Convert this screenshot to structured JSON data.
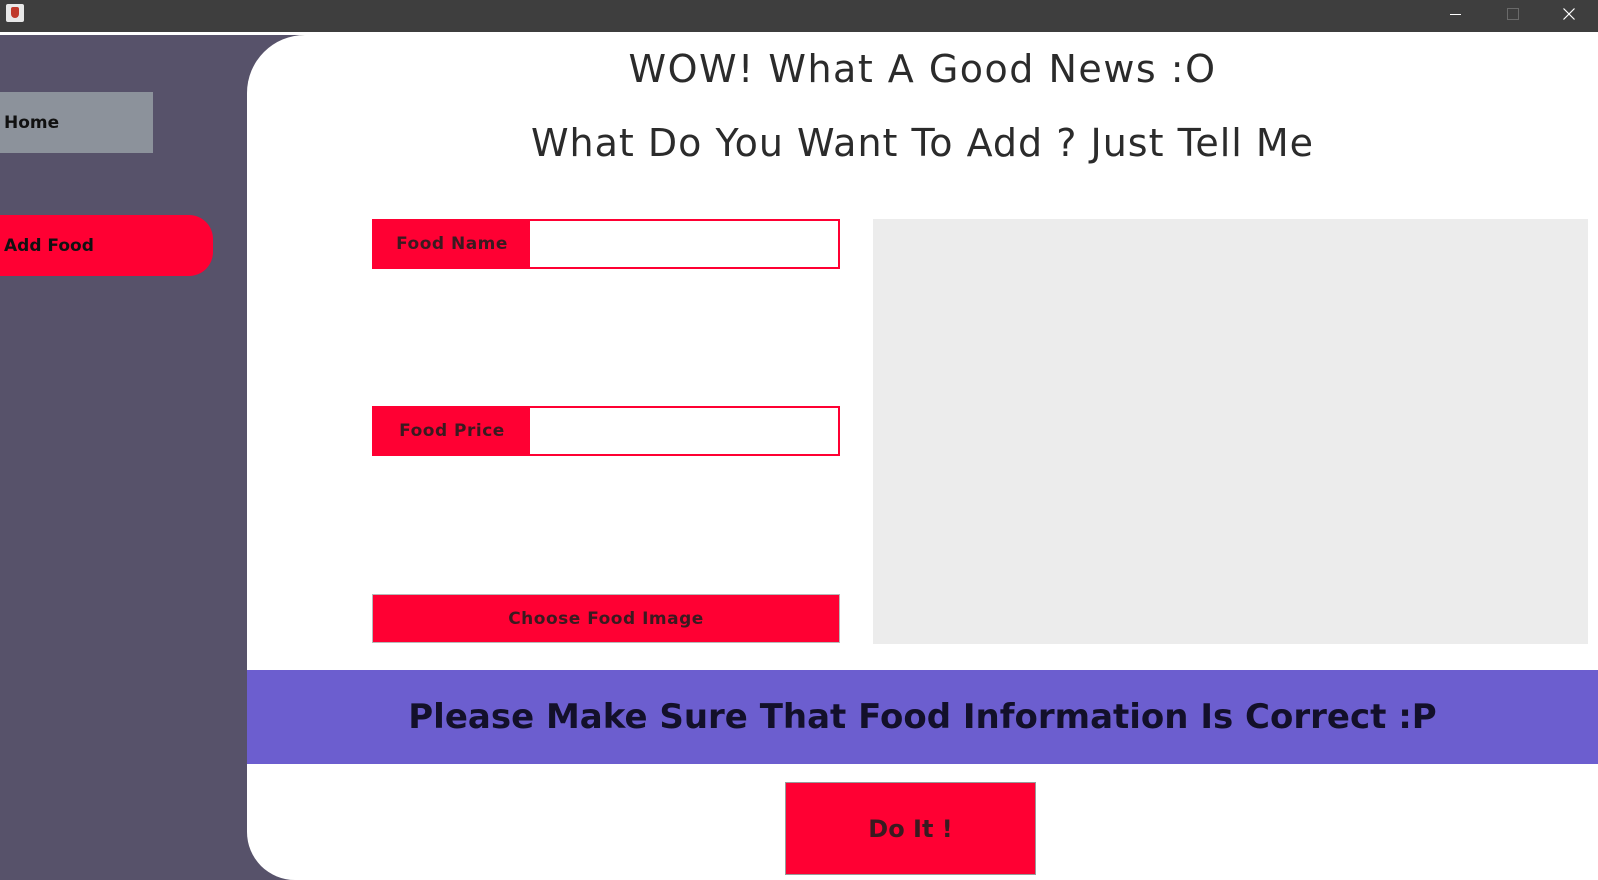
{
  "window": {
    "icon": "java-cup-icon",
    "controls": [
      "minimize-icon",
      "maximize-icon",
      "close-icon"
    ]
  },
  "sidebar": {
    "items": [
      {
        "label": "Home",
        "color": "#8c929b"
      },
      {
        "label": "Add Food",
        "color": "#ff0033",
        "active": true
      }
    ]
  },
  "main": {
    "heading": "WOW! What A Good News  :O",
    "subheading": "What Do You Want To Add ? Just Tell Me",
    "form": {
      "food_name_label": "Food Name",
      "food_name_value": "",
      "food_price_label": "Food Price",
      "food_price_value": "",
      "choose_image_label": "Choose Food Image"
    },
    "banner": "Please Make Sure That Food Information Is Correct  :P",
    "submit_label": "Do It !"
  },
  "colors": {
    "accent": "#ff0033",
    "sidebar_bg": "#57526a",
    "banner_bg": "#6c5ecf",
    "preview_bg": "#ececec"
  }
}
